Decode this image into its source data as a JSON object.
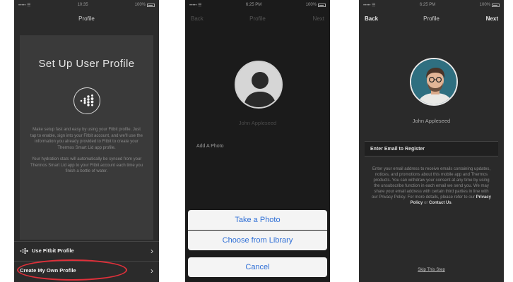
{
  "screen1": {
    "status_left": "••••• ☰",
    "status_time": "10:35",
    "status_battery": "100%",
    "nav_title": "Profile",
    "heading": "Set Up User Profile",
    "body_p1": "Make setup fast and easy by using your Fitbit profile. Just tap to enable, sign into your Fitbit account, and we'll use the information you already provided to Fitbit to create your Thermos Smart Lid app profile.",
    "body_p2": "Your hydration stats will automatically be synced from your Thermos Smart Lid app to your Fitbit account each time you finish a bottle of water.",
    "row_fitbit": "Use Fitbit Profile",
    "row_own": "Create My Own Profile"
  },
  "screen2": {
    "status_left": "••••• ☰",
    "status_time": "6:25 PM",
    "status_battery": "100%",
    "nav_back": "Back",
    "nav_title": "Profile",
    "nav_next": "Next",
    "name": "John Appleseed",
    "add_photo": "Add A Photo",
    "take_photo": "Take a Photo",
    "choose_library": "Choose from Library",
    "cancel": "Cancel"
  },
  "screen3": {
    "status_left": "••••• ☰",
    "status_time": "6:25 PM",
    "status_battery": "100%",
    "nav_back": "Back",
    "nav_title": "Profile",
    "nav_next": "Next",
    "name": "John Appleseed",
    "email_placeholder": "Enter Email to Register",
    "body_text": "Enter your email address to receive emails containing updates, notices, and promotions about this mobile app and Thermos products. You can withdraw your consent at any time by using the unsubscribe function in each email we send you. We may share your email address with certain third parties in line with our Privacy Policy. For more details, please refer to our",
    "privacy_link": "Privacy Policy",
    "or_text": "or",
    "contact_link": "Contact Us",
    "skip": "Skip This Step"
  },
  "colors": {
    "annotation_red": "#e0303a",
    "ios_blue": "#2f6fd6"
  }
}
